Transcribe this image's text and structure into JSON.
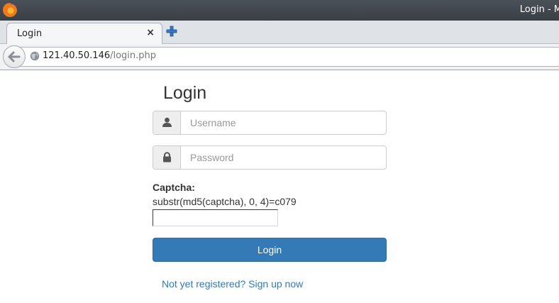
{
  "browser": {
    "window_title": "Login - M",
    "tab_title": "Login",
    "tab_close": "×",
    "url_host": "121.40.50.146",
    "url_path": "/login.php"
  },
  "page": {
    "heading": "Login",
    "username_placeholder": "Username",
    "password_placeholder": "Password",
    "captcha_label": "Captcha:",
    "captcha_hint": "substr(md5(captcha), 0, 4)=c079",
    "login_button": "Login",
    "signup_link": "Not yet registered? Sign up now"
  },
  "icons": {
    "browser_logo": "firefox-icon",
    "new_tab": "plus-icon",
    "back": "back-arrow-icon",
    "site_identity": "globe-icon",
    "username_addon": "user-icon",
    "password_addon": "lock-icon"
  },
  "colors": {
    "primary": "#337ab7",
    "titlebar": "#3e434a"
  }
}
